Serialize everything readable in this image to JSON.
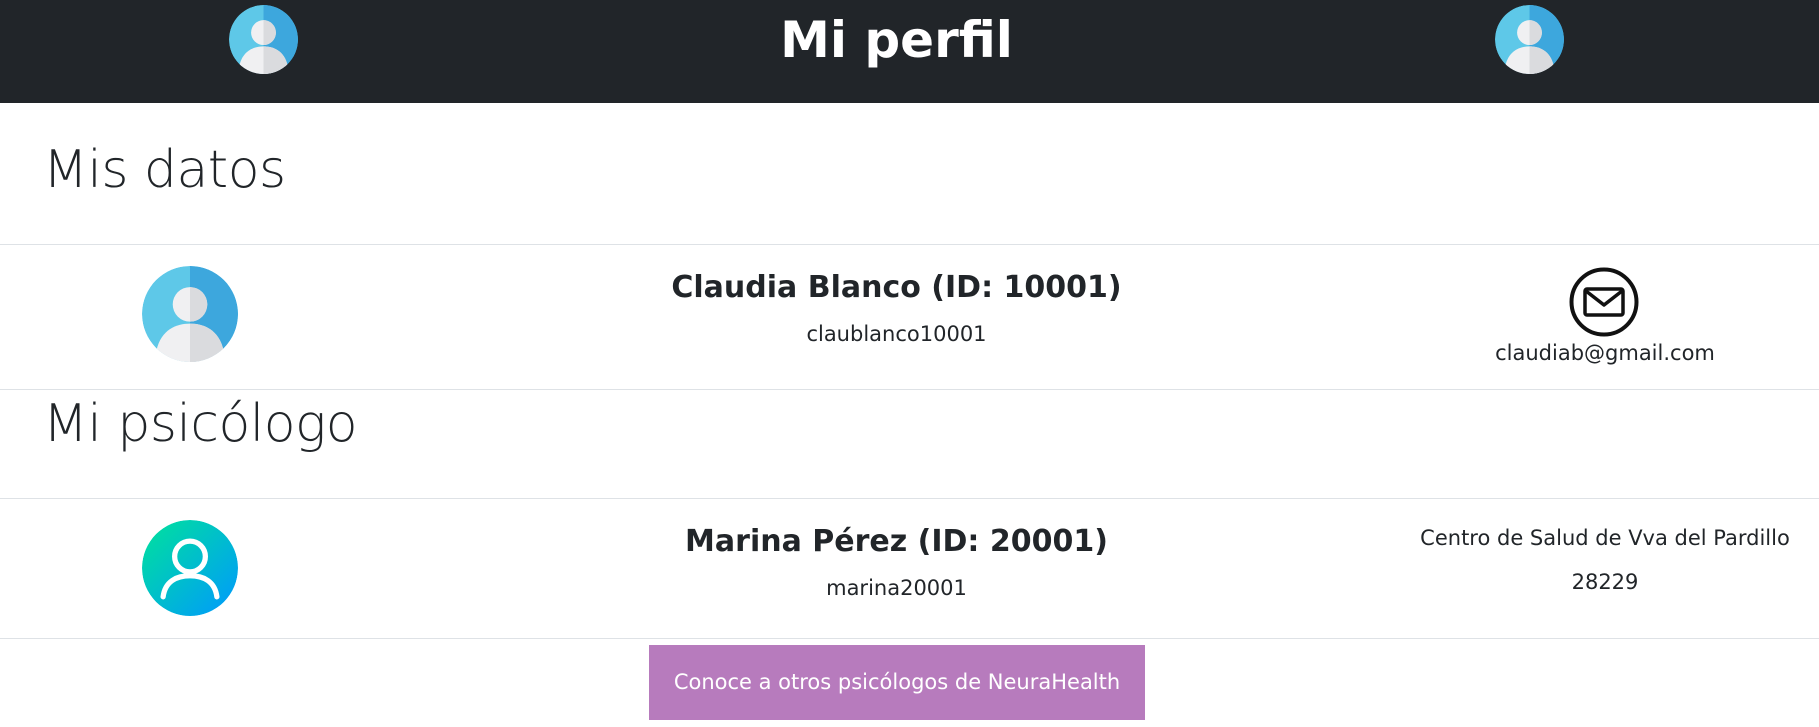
{
  "header": {
    "title": "Mi perfil",
    "left_icon": "user-avatar-icon",
    "right_icon": "user-avatar-icon"
  },
  "mis_datos": {
    "heading": "Mis datos",
    "avatar_icon": "user-avatar-icon",
    "name": "Claudia Blanco (ID: 10001)",
    "username": "claublanco10001",
    "contact_icon": "mail-icon",
    "email": "claudiab@gmail.com"
  },
  "mi_psicologo": {
    "heading": "Mi psicólogo",
    "avatar_icon": "psychologist-avatar-icon",
    "name": "Marina Pérez (ID: 20001)",
    "username": "marina20001",
    "center": "Centro de Salud de Vva del Pardillo",
    "postal_code": "28229"
  },
  "cta": {
    "label": "Conoce a otros psicólogos de NeuraHealth"
  },
  "colors": {
    "header_bg": "#212529",
    "cta_bg": "#b77bbd",
    "divider": "#dee2e6"
  }
}
